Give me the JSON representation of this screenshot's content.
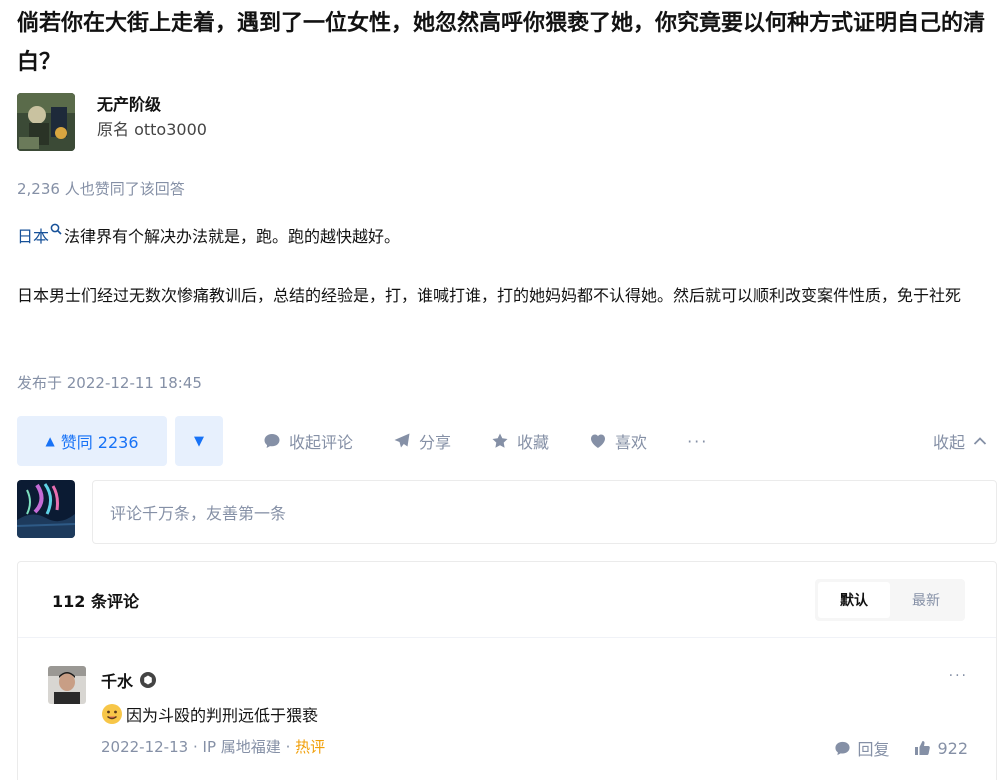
{
  "question": {
    "title": "倘若你在大街上走着，遇到了一位女性，她忽然高呼你猥亵了她，你究竟要以何种方式证明自己的清白？"
  },
  "author": {
    "name": "无产阶级",
    "bio": "原名 otto3000"
  },
  "answer": {
    "vote_summary": "2,236 人也赞同了该回答",
    "paragraph1_link": "日本",
    "paragraph1_rest": "法律界有个解决办法就是，跑。跑的越快越好。",
    "paragraph2": "日本男士们经过无数次惨痛教训后，总结的经验是，打，谁喊打谁，打的她妈妈都不认得她。然后就可以顺利改变案件性质，免于社死",
    "published": "发布于 2022-12-11 18:45"
  },
  "actions": {
    "upvote_label": "赞同 2236",
    "upvote_arrow": "▲",
    "downvote_arrow": "▼",
    "comments_label": "收起评论",
    "share_label": "分享",
    "favorite_label": "收藏",
    "like_label": "喜欢",
    "more_label": "···",
    "collapse_label": "收起"
  },
  "comment_box": {
    "placeholder": "评论千万条，友善第一条"
  },
  "comments": {
    "count_label": "112 条评论",
    "sort_default": "默认",
    "sort_latest": "最新",
    "items": [
      {
        "author": "千水",
        "text": "因为斗殴的判刑远低于猥亵",
        "date": "2022-12-13",
        "separator": "·",
        "ip": "IP 属地福建",
        "tag": "热评",
        "reply_label": "回复",
        "likes": "922",
        "more": "···"
      }
    ]
  },
  "colors": {
    "accent": "#1772f6",
    "accent_bg": "#e7f0fd",
    "muted": "#8590a6",
    "hot": "#f1a00b"
  }
}
